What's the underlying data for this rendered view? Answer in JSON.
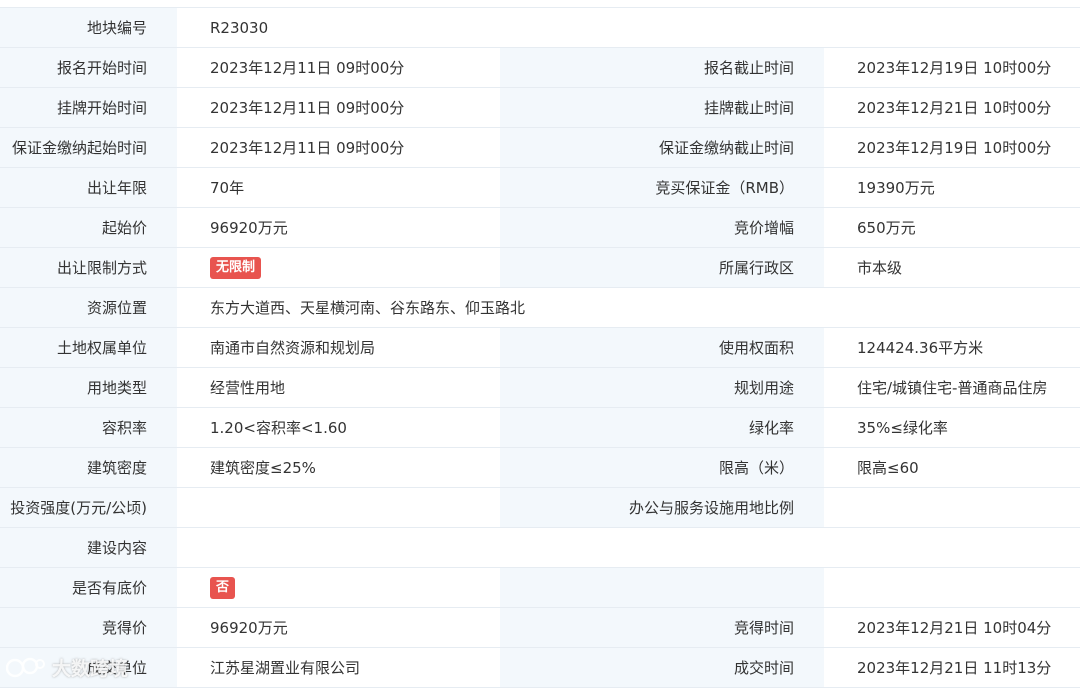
{
  "rows": [
    {
      "l1": "地块编号",
      "v1": "R23030"
    },
    {
      "l1": "报名开始时间",
      "v1": "2023年12月11日 09时00分",
      "l2": "报名截止时间",
      "v2": "2023年12月19日 10时00分"
    },
    {
      "l1": "挂牌开始时间",
      "v1": "2023年12月11日 09时00分",
      "l2": "挂牌截止时间",
      "v2": "2023年12月21日 10时00分"
    },
    {
      "l1": "保证金缴纳起始时间",
      "v1": "2023年12月11日 09时00分",
      "l2": "保证金缴纳截止时间",
      "v2": "2023年12月19日 10时00分"
    },
    {
      "l1": "出让年限",
      "v1": "70年",
      "l2": "竞买保证金（RMB）",
      "v2": "19390万元"
    },
    {
      "l1": "起始价",
      "v1": "96920万元",
      "l2": "竞价增幅",
      "v2": "650万元"
    },
    {
      "l1": "出让限制方式",
      "v1_tag": "无限制",
      "l2": "所属行政区",
      "v2": "市本级"
    },
    {
      "l1": "资源位置",
      "v1": "东方大道西、天星横河南、谷东路东、仰玉路北"
    },
    {
      "l1": "土地权属单位",
      "v1": "南通市自然资源和规划局",
      "l2": "使用权面积",
      "v2": "124424.36平方米"
    },
    {
      "l1": "用地类型",
      "v1": "经营性用地",
      "l2": "规划用途",
      "v2": "住宅/城镇住宅-普通商品住房"
    },
    {
      "l1": "容积率",
      "v1": "1.20<容积率<1.60",
      "l2": "绿化率",
      "v2": "35%≤绿化率"
    },
    {
      "l1": "建筑密度",
      "v1": "建筑密度≤25%",
      "l2": "限高（米）",
      "v2": "限高≤60"
    },
    {
      "l1": "投资强度(万元/公顷)",
      "v1": "",
      "l2": "办公与服务设施用地比例",
      "v2": ""
    },
    {
      "l1": "建设内容",
      "v1": ""
    },
    {
      "l1": "是否有底价",
      "v1_tag": "否",
      "l2": "",
      "v2": ""
    },
    {
      "l1": "竞得价",
      "v1": "96920万元",
      "l2": "竞得时间",
      "v2": "2023年12月21日 10时04分"
    },
    {
      "l1": "成交单位",
      "v1": "江苏星湖置业有限公司",
      "l2": "成交时间",
      "v2": "2023年12月21日 11时13分"
    }
  ],
  "watermark": {
    "text": "大数跨境"
  },
  "colors": {
    "label_bg": "#f3f8fc",
    "tag_bg": "#e8544f",
    "border": "#e6ecf2"
  }
}
